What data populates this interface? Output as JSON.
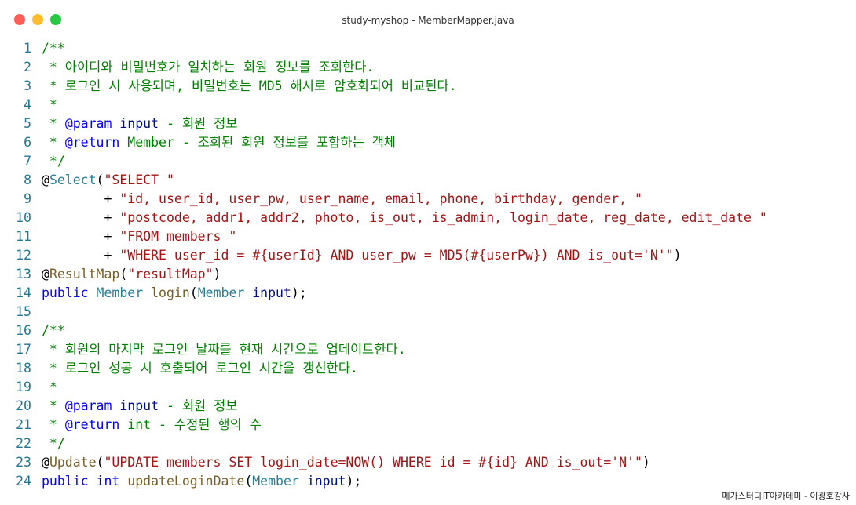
{
  "window": {
    "title": "study-myshop - MemberMapper.java"
  },
  "code": {
    "lines": [
      {
        "n": "1",
        "tokens": [
          {
            "t": "/**",
            "c": "c"
          }
        ]
      },
      {
        "n": "2",
        "tokens": [
          {
            "t": " * 아이디와 비밀번호가 일치하는 회원 정보를 조회한다.",
            "c": "c"
          }
        ]
      },
      {
        "n": "3",
        "tokens": [
          {
            "t": " * 로그인 시 사용되며, 비밀번호는 MD5 해시로 암호화되어 비교된다.",
            "c": "c"
          }
        ]
      },
      {
        "n": "4",
        "tokens": [
          {
            "t": " *",
            "c": "c"
          }
        ]
      },
      {
        "n": "5",
        "tokens": [
          {
            "t": " * ",
            "c": "c"
          },
          {
            "t": "@param",
            "c": "tag"
          },
          {
            "t": " ",
            "c": "c"
          },
          {
            "t": "input",
            "c": "var"
          },
          {
            "t": " - 회원 정보",
            "c": "c"
          }
        ]
      },
      {
        "n": "6",
        "tokens": [
          {
            "t": " * ",
            "c": "c"
          },
          {
            "t": "@return",
            "c": "tag"
          },
          {
            "t": " Member - 조회된 회원 정보를 포함하는 객체",
            "c": "c"
          }
        ]
      },
      {
        "n": "7",
        "tokens": [
          {
            "t": " */",
            "c": "c"
          }
        ]
      },
      {
        "n": "8",
        "tokens": [
          {
            "t": "@",
            "c": ""
          },
          {
            "t": "Select",
            "c": "ty"
          },
          {
            "t": "(",
            "c": ""
          },
          {
            "t": "\"SELECT \"",
            "c": "str"
          }
        ]
      },
      {
        "n": "9",
        "tokens": [
          {
            "t": "        + ",
            "c": ""
          },
          {
            "t": "\"id, user_id, user_pw, user_name, email, phone, birthday, gender, \"",
            "c": "str"
          }
        ]
      },
      {
        "n": "10",
        "tokens": [
          {
            "t": "        + ",
            "c": ""
          },
          {
            "t": "\"postcode, addr1, addr2, photo, is_out, is_admin, login_date, reg_date, edit_date \"",
            "c": "str"
          }
        ]
      },
      {
        "n": "11",
        "tokens": [
          {
            "t": "        + ",
            "c": ""
          },
          {
            "t": "\"FROM members \"",
            "c": "str"
          }
        ]
      },
      {
        "n": "12",
        "tokens": [
          {
            "t": "        + ",
            "c": ""
          },
          {
            "t": "\"WHERE user_id = #{userId} AND user_pw = MD5(#{userPw}) AND is_out='N'\"",
            "c": "str"
          },
          {
            "t": ")",
            "c": ""
          }
        ]
      },
      {
        "n": "13",
        "tokens": [
          {
            "t": "@",
            "c": ""
          },
          {
            "t": "ResultMap",
            "c": "ann"
          },
          {
            "t": "(",
            "c": ""
          },
          {
            "t": "\"resultMap\"",
            "c": "str"
          },
          {
            "t": ")",
            "c": ""
          }
        ]
      },
      {
        "n": "14",
        "tokens": [
          {
            "t": "public",
            "c": "kw"
          },
          {
            "t": " ",
            "c": ""
          },
          {
            "t": "Member",
            "c": "ty"
          },
          {
            "t": " ",
            "c": ""
          },
          {
            "t": "login",
            "c": "fn"
          },
          {
            "t": "(",
            "c": ""
          },
          {
            "t": "Member",
            "c": "ty"
          },
          {
            "t": " ",
            "c": ""
          },
          {
            "t": "input",
            "c": "var"
          },
          {
            "t": ");",
            "c": ""
          }
        ]
      },
      {
        "n": "15",
        "tokens": []
      },
      {
        "n": "16",
        "tokens": [
          {
            "t": "/**",
            "c": "c"
          }
        ]
      },
      {
        "n": "17",
        "tokens": [
          {
            "t": " * 회원의 마지막 로그인 날짜를 현재 시간으로 업데이트한다.",
            "c": "c"
          }
        ]
      },
      {
        "n": "18",
        "tokens": [
          {
            "t": " * 로그인 성공 시 호출되어 로그인 시간을 갱신한다.",
            "c": "c"
          }
        ]
      },
      {
        "n": "19",
        "tokens": [
          {
            "t": " *",
            "c": "c"
          }
        ]
      },
      {
        "n": "20",
        "tokens": [
          {
            "t": " * ",
            "c": "c"
          },
          {
            "t": "@param",
            "c": "tag"
          },
          {
            "t": " ",
            "c": "c"
          },
          {
            "t": "input",
            "c": "var"
          },
          {
            "t": " - 회원 정보",
            "c": "c"
          }
        ]
      },
      {
        "n": "21",
        "tokens": [
          {
            "t": " * ",
            "c": "c"
          },
          {
            "t": "@return",
            "c": "tag"
          },
          {
            "t": " int - 수정된 행의 수",
            "c": "c"
          }
        ]
      },
      {
        "n": "22",
        "tokens": [
          {
            "t": " */",
            "c": "c"
          }
        ]
      },
      {
        "n": "23",
        "tokens": [
          {
            "t": "@",
            "c": ""
          },
          {
            "t": "Update",
            "c": "ann"
          },
          {
            "t": "(",
            "c": ""
          },
          {
            "t": "\"UPDATE members SET login_date=NOW() WHERE id = #{id} AND is_out='N'\"",
            "c": "str"
          },
          {
            "t": ")",
            "c": ""
          }
        ]
      },
      {
        "n": "24",
        "tokens": [
          {
            "t": "public",
            "c": "kw"
          },
          {
            "t": " ",
            "c": ""
          },
          {
            "t": "int",
            "c": "kw"
          },
          {
            "t": " ",
            "c": ""
          },
          {
            "t": "updateLoginDate",
            "c": "fn"
          },
          {
            "t": "(",
            "c": ""
          },
          {
            "t": "Member",
            "c": "ty"
          },
          {
            "t": " ",
            "c": ""
          },
          {
            "t": "input",
            "c": "var"
          },
          {
            "t": ");",
            "c": ""
          }
        ]
      }
    ]
  },
  "footer": {
    "credit": "메가스터디IT아카데미 - 이광호강사"
  },
  "colors": {
    "close": "#ff5f57",
    "minimize": "#febc2e",
    "zoom": "#28c840",
    "comment": "#008000",
    "string": "#a31515",
    "keyword": "#0000ff",
    "type": "#267f99",
    "line_number": "#237893"
  }
}
